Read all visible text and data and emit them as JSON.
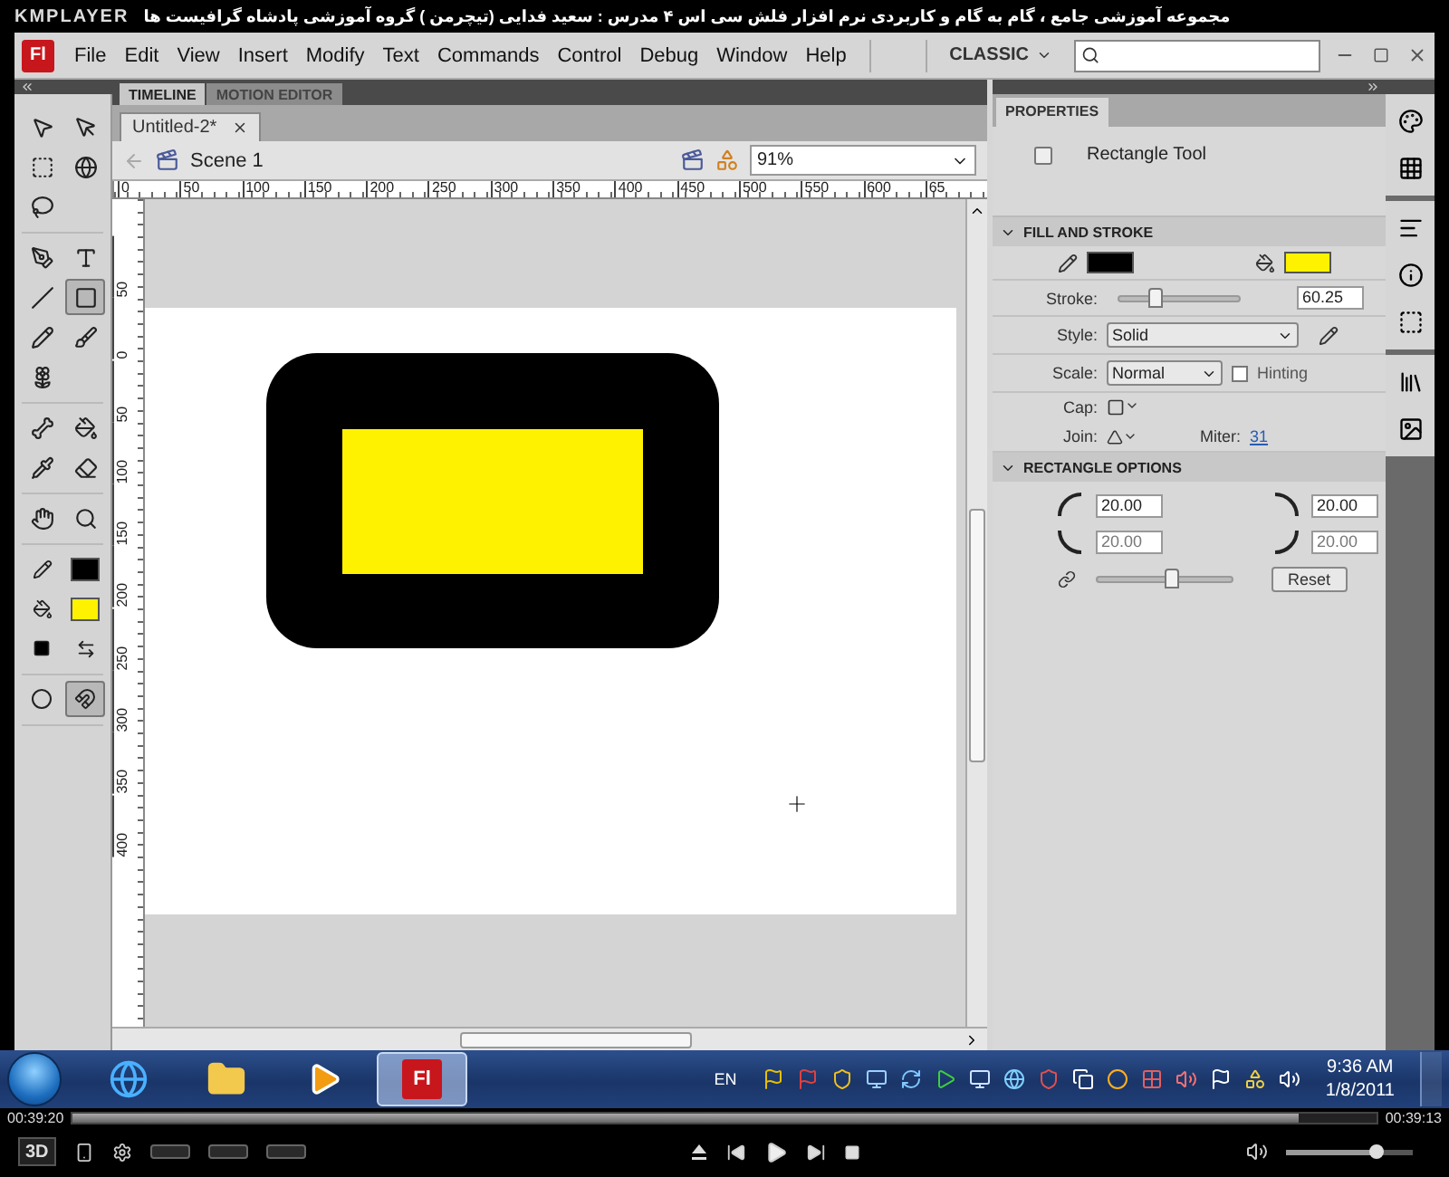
{
  "player": {
    "brand": "KMPLAYER",
    "title": "مجموعه آموزشی جامع ، گام به گام و کاربردی نرم افزار فلش سی اس ۴ مدرس : سعید فدایی (تیچرمن ) گروه آموزشی پادشاه گرافیست ها",
    "elapsed": "00:39:20",
    "remaining": "00:39:13",
    "position": {
      "level": 0.94
    },
    "volume": {
      "level": 0.72
    },
    "mode": "3D"
  },
  "menu_bar": {
    "logo": "Fl",
    "items": [
      "File",
      "Edit",
      "View",
      "Insert",
      "Modify",
      "Text",
      "Commands",
      "Control",
      "Debug",
      "Window",
      "Help"
    ],
    "workspace": "CLASSIC"
  },
  "panel_tabs": [
    {
      "label": "TIMELINE",
      "selected": true
    },
    {
      "label": "MOTION EDITOR",
      "selected": false
    }
  ],
  "document_tabs": [
    {
      "label": "Untitled-2*",
      "selected": true
    }
  ],
  "scene": "Scene 1",
  "zoom": "91%",
  "ruler_h": [
    "0",
    "50",
    "100",
    "150",
    "200",
    "250",
    "300",
    "350",
    "400",
    "450",
    "500",
    "550",
    "600",
    "65"
  ],
  "ruler_v": [
    "50",
    "0",
    "50",
    "100",
    "150",
    "200",
    "250",
    "300",
    "350",
    "400"
  ],
  "tool_groups": [
    [
      {
        "kind": "selection",
        "selected": false
      },
      {
        "kind": "subselection",
        "selected": false
      },
      {
        "kind": "free-transform",
        "selected": false
      },
      {
        "kind": "rotation",
        "selected": false
      },
      {
        "kind": "lasso",
        "selected": false
      }
    ],
    [
      {
        "kind": "pen",
        "selected": false
      },
      {
        "kind": "text",
        "selected": false
      },
      {
        "kind": "line",
        "selected": false
      },
      {
        "kind": "rectangle",
        "selected": true
      },
      {
        "kind": "pencil",
        "selected": false
      },
      {
        "kind": "brush",
        "selected": false
      },
      {
        "kind": "deco",
        "selected": false
      }
    ],
    [
      {
        "kind": "bone",
        "selected": false
      },
      {
        "kind": "paint-bucket",
        "selected": false
      },
      {
        "kind": "eyedropper",
        "selected": false
      },
      {
        "kind": "eraser",
        "selected": false
      }
    ],
    [
      {
        "kind": "hand",
        "selected": false
      },
      {
        "kind": "zoom",
        "selected": false
      }
    ]
  ],
  "colors": [
    {
      "kind": "stroke",
      "color": "#000000"
    },
    {
      "kind": "fill",
      "color": "#fff200"
    }
  ],
  "drawing_options": [
    {
      "kind": "object-drawing",
      "selected": false
    },
    {
      "kind": "snap",
      "selected": true
    }
  ],
  "properties": {
    "title": "PROPERTIES",
    "tool": "Rectangle Tool",
    "fill_stroke": {
      "title": "FILL AND STROKE",
      "expanded": true,
      "stroke": {
        "label": "Stroke:",
        "level": 0.3,
        "value": "60.25"
      },
      "style": {
        "label": "Style:",
        "value": "Solid"
      },
      "scale": {
        "label": "Scale:",
        "value": "Normal"
      },
      "hinting": {
        "label": "Hinting",
        "checked": false
      },
      "cap": {
        "label": "Cap:"
      },
      "join": {
        "label": "Join:"
      },
      "miter": {
        "label": "Miter:",
        "value": "31"
      }
    },
    "rectangle_options": {
      "title": "RECTANGLE OPTIONS",
      "expanded": true,
      "corners": [
        "20.00",
        "20.00",
        "20.00",
        "20.00"
      ],
      "radius": {
        "level": 0.55
      },
      "reset": "Reset"
    }
  },
  "taskbar": {
    "apps": [
      {
        "kind": "internet-explorer",
        "selected": false
      },
      {
        "kind": "file-explorer",
        "selected": false
      },
      {
        "kind": "media-player",
        "selected": false
      },
      {
        "kind": "flash",
        "label": "Fl",
        "selected": true
      }
    ],
    "language": "EN",
    "time": "9:36 AM",
    "date": "1/8/2011"
  }
}
